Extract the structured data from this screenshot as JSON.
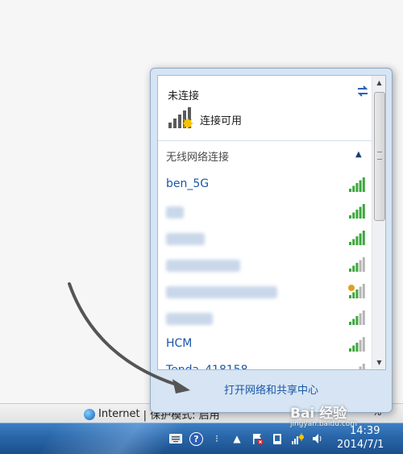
{
  "popup": {
    "connection_status": "未连接",
    "available_label": "连接可用",
    "section_title": "无线网络连接",
    "networks": [
      {
        "name": "ben_5G",
        "strength": 5,
        "secured": false
      },
      {
        "name": "",
        "strength": 5,
        "secured": false
      },
      {
        "name": "",
        "strength": 5,
        "secured": false
      },
      {
        "name": "",
        "strength": 3,
        "secured": false
      },
      {
        "name": "",
        "strength": 3,
        "secured": true
      },
      {
        "name": "",
        "strength": 3,
        "secured": false
      },
      {
        "name": "HCM",
        "strength": 3,
        "secured": false
      },
      {
        "name": "Tenda_418158",
        "strength": 3,
        "secured": false
      }
    ],
    "open_center_link": "打开网络和共享中心"
  },
  "statusbar": {
    "zone_label": "Internet",
    "mode_text": "| 保护模式: 启用",
    "zoom": "%"
  },
  "taskbar": {
    "time": "14:39",
    "date": "2014/7/1"
  },
  "watermark": {
    "brand": "Bai 经验",
    "url": "jingyan.baidu.com"
  },
  "colors": {
    "accent_link": "#1b57a6",
    "signal_strong": "#3da83d",
    "signal_weak": "#b5b5b5",
    "taskbar": "#2a68ab"
  }
}
